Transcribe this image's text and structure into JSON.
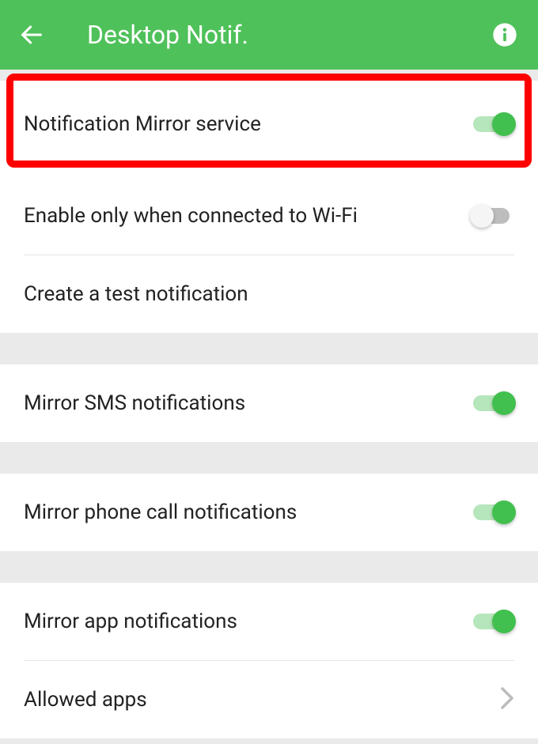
{
  "header": {
    "title": "Desktop Notif."
  },
  "settings": {
    "mirror_service": {
      "label": "Notification Mirror service",
      "on": true
    },
    "wifi_only": {
      "label": "Enable only when connected to Wi-Fi",
      "on": false
    },
    "test_notification": {
      "label": "Create a test notification"
    },
    "mirror_sms": {
      "label": "Mirror SMS notifications",
      "on": true
    },
    "mirror_phone": {
      "label": "Mirror phone call notifications",
      "on": true
    },
    "mirror_app": {
      "label": "Mirror app notifications",
      "on": true
    },
    "allowed_apps": {
      "label": "Allowed apps"
    }
  }
}
